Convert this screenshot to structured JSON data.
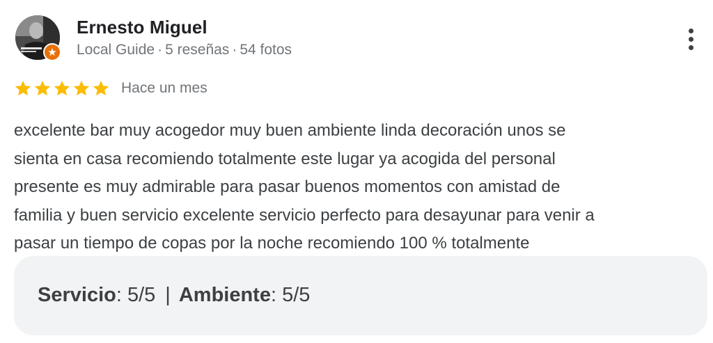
{
  "reviewer": {
    "name": "Ernesto Miguel",
    "badge": "Local Guide",
    "separator": "·",
    "reviews": "5 reseñas",
    "photos": "54 fotos"
  },
  "rating": {
    "stars": 5,
    "max_stars": 5,
    "star_color": "#fbbc04",
    "time": "Hace un mes"
  },
  "review": {
    "lines": [
      "excelente bar muy acogedor muy buen ambiente linda decoración unos se",
      "sienta en casa recomiendo totalmente este lugar ya acogida del personal",
      "presente es muy admirable para pasar buenos momentos con amistad de",
      "familia y buen servicio excelente servicio perfecto para desayunar para venir a",
      "pasar un tiempo de copas por la noche recomiendo 100 % totalmente"
    ]
  },
  "attributes": {
    "items": [
      {
        "label": "Servicio",
        "value": "5/5"
      },
      {
        "label": "Ambiente",
        "value": "5/5"
      }
    ],
    "separator": "|"
  },
  "icons": {
    "menu": "more-vert-icon",
    "badge": "local-guide-star-icon",
    "star": "star-icon"
  },
  "colors": {
    "badge": "#e8710a",
    "meta_text": "#70757a",
    "attributes_bg": "#f1f3f4"
  }
}
